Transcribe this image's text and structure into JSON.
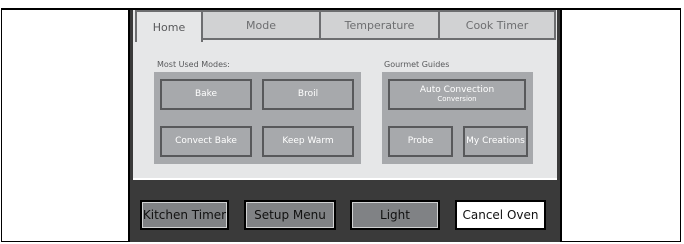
{
  "tabs": [
    "Home",
    "Mode",
    "Temperature",
    "Cook Timer"
  ],
  "active_tab": "Home",
  "most_used": {
    "label": "Most Used Modes:",
    "buttons": [
      "Bake",
      "Broil",
      "Convect Bake",
      "Keep Warm"
    ]
  },
  "gourmet": {
    "label": "Gourmet Guides",
    "auto_convection": {
      "title": "Auto Convection",
      "subtitle": "Conversion"
    },
    "probe": "Probe",
    "my_creations": "My Creations"
  },
  "bottom": {
    "kitchen_timer": "Kitchen Timer",
    "setup_menu": "Setup Menu",
    "light": "Light",
    "cancel_oven": "Cancel Oven"
  }
}
